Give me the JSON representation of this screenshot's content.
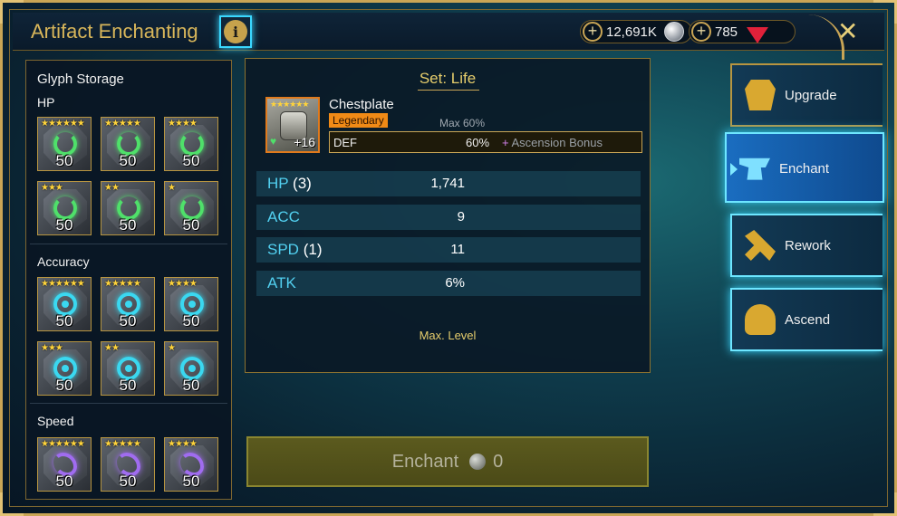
{
  "header": {
    "title": "Artifact Enchanting",
    "info_label": "i",
    "silver": "12,691K",
    "gems": "785",
    "close_label": "✕",
    "plus_label": "+"
  },
  "glyph_storage": {
    "title": "Glyph Storage",
    "groups": [
      {
        "name": "HP",
        "glyphs": [
          {
            "stars": "★★★★★★",
            "level": "50"
          },
          {
            "stars": "★★★★★",
            "level": "50"
          },
          {
            "stars": "★★★★",
            "level": "50"
          },
          {
            "stars": "★★★",
            "level": "50"
          },
          {
            "stars": "★★",
            "level": "50"
          },
          {
            "stars": "★",
            "level": "50"
          }
        ]
      },
      {
        "name": "Accuracy",
        "glyphs": [
          {
            "stars": "★★★★★★",
            "level": "50"
          },
          {
            "stars": "★★★★★",
            "level": "50"
          },
          {
            "stars": "★★★★",
            "level": "50"
          },
          {
            "stars": "★★★",
            "level": "50"
          },
          {
            "stars": "★★",
            "level": "50"
          },
          {
            "stars": "★",
            "level": "50"
          }
        ]
      },
      {
        "name": "Speed",
        "glyphs": [
          {
            "stars": "★★★★★★",
            "level": "50"
          },
          {
            "stars": "★★★★★",
            "level": "50"
          },
          {
            "stars": "★★★★",
            "level": "50"
          }
        ]
      }
    ]
  },
  "artifact": {
    "set_title": "Set: Life",
    "name": "Chestplate",
    "rarity": "Legendary",
    "stars": "★★★★★★",
    "level": "+16",
    "max_pct": "Max 60%",
    "main_stat": {
      "name": "DEF",
      "value": "60%",
      "bonus_plus": "+",
      "bonus": "Ascension Bonus"
    },
    "substats": [
      {
        "name": "HP",
        "rolls": "(3)",
        "value": "1,741"
      },
      {
        "name": "ACC",
        "rolls": "",
        "value": "9"
      },
      {
        "name": "SPD",
        "rolls": "(1)",
        "value": "11"
      },
      {
        "name": "ATK",
        "rolls": "",
        "value": "6%"
      }
    ],
    "max_level_label": "Max. Level"
  },
  "enchant_button": {
    "label": "Enchant",
    "cost": "0"
  },
  "tabs": [
    {
      "label": "Upgrade",
      "icon": "armor-icon",
      "active": false
    },
    {
      "label": "Enchant",
      "icon": "anvil-icon",
      "active": true
    },
    {
      "label": "Rework",
      "icon": "tools-icon",
      "active": false
    },
    {
      "label": "Ascend",
      "icon": "helmet-icon",
      "active": false
    }
  ],
  "colors": {
    "gold": "#c9a555",
    "title_gold": "#d8b65a",
    "active_tab": "#1a6dc0",
    "glow": "#3ad8ff",
    "legendary": "#f08a16"
  }
}
